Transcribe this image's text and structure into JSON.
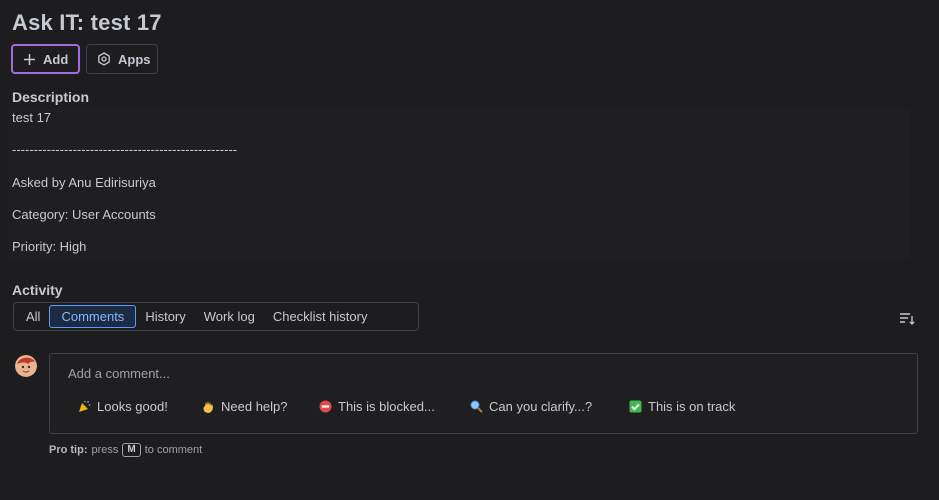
{
  "page": {
    "title": "Ask IT: test 17"
  },
  "toolbar": {
    "add_label": "Add",
    "apps_label": "Apps"
  },
  "description": {
    "heading": "Description",
    "lines": [
      "test 17",
      "----------------------------------------------------",
      "Asked by Anu Edirisuriya",
      "Category: User Accounts",
      "Priority: High"
    ]
  },
  "activity": {
    "heading": "Activity",
    "tabs": [
      "All",
      "Comments",
      "History",
      "Work log",
      "Checklist history"
    ],
    "active_tab": "Comments"
  },
  "comment": {
    "placeholder": "Add a comment...",
    "quick_replies": [
      {
        "icon": "party-popper-icon",
        "label": "Looks good!"
      },
      {
        "icon": "waving-hand-icon",
        "label": "Need help?"
      },
      {
        "icon": "no-entry-icon",
        "label": "This is blocked..."
      },
      {
        "icon": "magnifier-icon",
        "label": "Can you clarify...?"
      },
      {
        "icon": "check-box-icon",
        "label": "This is on track"
      }
    ]
  },
  "protip": {
    "label": "Pro tip:",
    "pre": "press",
    "key": "M",
    "post": "to comment"
  },
  "colors": {
    "accent_focus": "#a36bdb",
    "tab_active_border": "#579dff",
    "background": "#1d1d20"
  }
}
